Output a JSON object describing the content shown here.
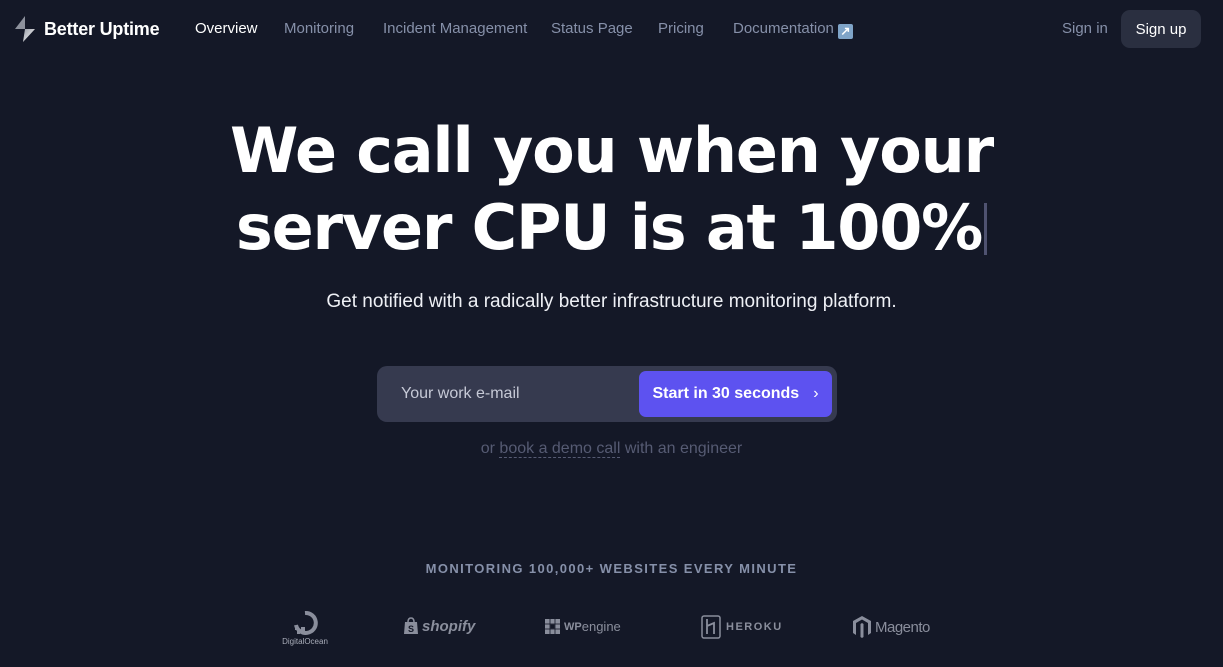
{
  "brand": {
    "name": "Better Uptime",
    "logo_icon": "lightning-bolt-icon"
  },
  "nav": {
    "links": [
      {
        "label": "Overview",
        "active": true
      },
      {
        "label": "Monitoring",
        "active": false
      },
      {
        "label": "Incident Management",
        "active": false
      },
      {
        "label": "Status Page",
        "active": false
      },
      {
        "label": "Pricing",
        "active": false
      },
      {
        "label": "Documentation",
        "active": false,
        "icon": "external-link-icon",
        "icon_glyph": "↗"
      }
    ],
    "sign_in": "Sign in",
    "sign_up": "Sign up"
  },
  "hero": {
    "title_line1": "We call you when your",
    "title_line2": "server CPU is at 100%",
    "subtitle": "Get notified with a radically better infrastructure monitoring platform."
  },
  "signup_form": {
    "email_placeholder": "Your work e-mail",
    "email_value": "",
    "submit_label": "Start in 30 seconds",
    "submit_icon": "›"
  },
  "demo": {
    "prefix": "or ",
    "link_label": "book a demo call",
    "suffix": " with an engineer"
  },
  "social_proof": {
    "caption": "MONITORING 100,000+ WEBSITES EVERY MINUTE",
    "logos": [
      {
        "name": "DigitalOcean"
      },
      {
        "name": "shopify"
      },
      {
        "name": "WP engine",
        "part1": "WP",
        "part2": "engine"
      },
      {
        "name": "HEROKU"
      },
      {
        "name": "Magento"
      }
    ]
  },
  "colors": {
    "background": "#141827",
    "accent": "#5d52f0",
    "nav_text": "#8690a9",
    "input_bg": "#363a4f"
  }
}
